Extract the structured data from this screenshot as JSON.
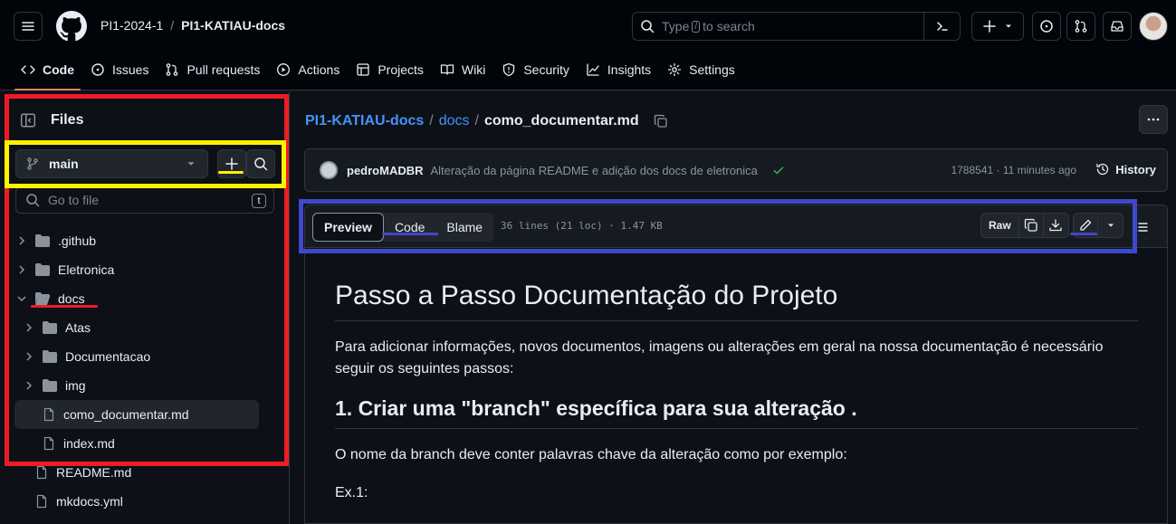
{
  "header": {
    "org": "PI1-2024-1",
    "separator": "/",
    "repo": "PI1-KATIAU-docs",
    "search_prefix": "Type",
    "search_key": "/",
    "search_suffix": "to search"
  },
  "nav_tabs": [
    {
      "label": "Code",
      "icon": "code-icon",
      "active": true
    },
    {
      "label": "Issues",
      "icon": "issue-icon"
    },
    {
      "label": "Pull requests",
      "icon": "pull-request-icon"
    },
    {
      "label": "Actions",
      "icon": "play-icon"
    },
    {
      "label": "Projects",
      "icon": "table-icon"
    },
    {
      "label": "Wiki",
      "icon": "book-icon"
    },
    {
      "label": "Security",
      "icon": "shield-icon"
    },
    {
      "label": "Insights",
      "icon": "graph-icon"
    },
    {
      "label": "Settings",
      "icon": "gear-icon"
    }
  ],
  "sidebar": {
    "title": "Files",
    "branch": "main",
    "goto_placeholder": "Go to file",
    "goto_key": "t",
    "tree": [
      {
        "label": ".github",
        "type": "folder",
        "expanded": false,
        "depth": 0
      },
      {
        "label": "Eletronica",
        "type": "folder",
        "expanded": false,
        "depth": 0
      },
      {
        "label": "docs",
        "type": "folder",
        "expanded": true,
        "depth": 0
      },
      {
        "label": "Atas",
        "type": "folder",
        "expanded": false,
        "depth": 1
      },
      {
        "label": "Documentacao",
        "type": "folder",
        "expanded": false,
        "depth": 1
      },
      {
        "label": "img",
        "type": "folder",
        "expanded": false,
        "depth": 1
      },
      {
        "label": "como_documentar.md",
        "type": "file",
        "selected": true,
        "depth": 1
      },
      {
        "label": "index.md",
        "type": "file",
        "depth": 1
      },
      {
        "label": "README.md",
        "type": "file",
        "depth": 0
      },
      {
        "label": "mkdocs.yml",
        "type": "file",
        "depth": 0
      }
    ]
  },
  "main": {
    "breadcrumb": {
      "repo": "PI1-KATIAU-docs",
      "folder": "docs",
      "file": "como_documentar.md",
      "sep": "/"
    },
    "commit": {
      "author": "pedroMADBR",
      "message": "Alteração da página README e adição dos docs de eletronica",
      "meta": "1788541 · 11 minutes ago",
      "history": "History"
    },
    "file_tabs": [
      "Preview",
      "Code",
      "Blame"
    ],
    "file_info": "36 lines (21 loc) · 1.47 KB",
    "raw_label": "Raw",
    "doc": {
      "h1": "Passo a Passo Documentação do Projeto",
      "p1": "Para adicionar informações, novos documentos, imagens ou alterações em geral na nossa documentação é necessário seguir os seguintes passos:",
      "h2": "1. Criar uma \"branch\" específica para sua alteração .",
      "p2": "O nome da branch deve conter palavras chave da alteração como por exemplo:",
      "p3": "Ex.1:"
    }
  },
  "annotation_colors": {
    "red": "#ed1c24",
    "yellow": "#fff200",
    "blue": "#3f48cc"
  }
}
